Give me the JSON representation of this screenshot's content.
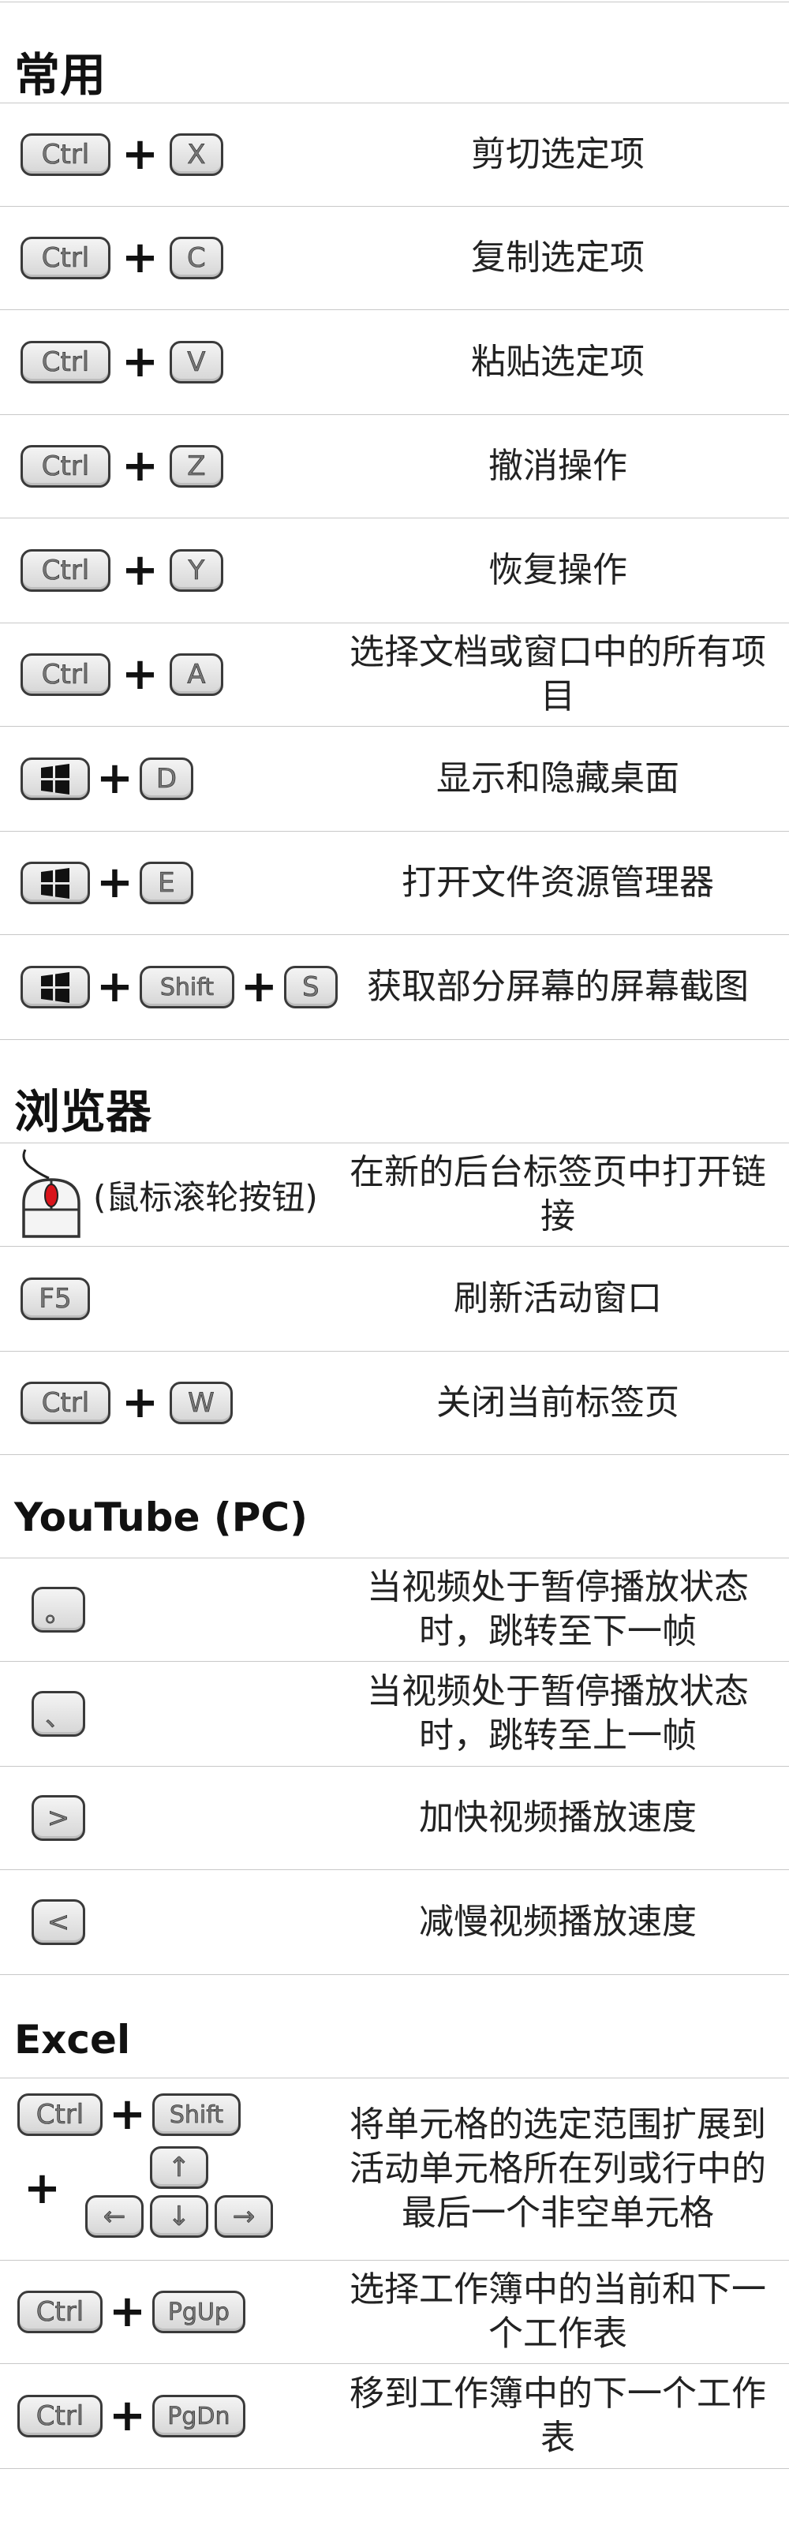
{
  "sections": {
    "common": {
      "heading": "常用",
      "rows": [
        {
          "k1": "Ctrl",
          "plus": "+",
          "k2": "X",
          "desc": "剪切选定项"
        },
        {
          "k1": "Ctrl",
          "plus": "+",
          "k2": "C",
          "desc": "复制选定项"
        },
        {
          "k1": "Ctrl",
          "plus": "+",
          "k2": "V",
          "desc": "粘贴选定项"
        },
        {
          "k1": "Ctrl",
          "plus": "+",
          "k2": "Z",
          "desc": "撤消操作"
        },
        {
          "k1": "Ctrl",
          "plus": "+",
          "k2": "Y",
          "desc": "恢复操作"
        },
        {
          "k1": "Ctrl",
          "plus": "+",
          "k2": "A",
          "desc": "选择文档或窗口中的所有项目"
        },
        {
          "k1": "windows-logo-icon",
          "plus": "+",
          "k2": "D",
          "desc": "显示和隐藏桌面"
        },
        {
          "k1": "windows-logo-icon",
          "plus": "+",
          "k2": "E",
          "desc": "打开文件资源管理器"
        },
        {
          "k1": "windows-logo-icon",
          "plus": "+",
          "k2": "Shift",
          "plus2": "+",
          "k3": "S",
          "desc": "获取部分屏幕的屏幕截图"
        }
      ]
    },
    "browser": {
      "heading": "浏览器",
      "rows": [
        {
          "icon": "mouse-icon",
          "label": "(鼠标滚轮按钮)",
          "desc": "在新的后台标签页中打开链接"
        },
        {
          "k1": "F5",
          "desc": "刷新活动窗口"
        },
        {
          "k1": "Ctrl",
          "plus": "+",
          "k2": "W",
          "desc": "关闭当前标签页"
        }
      ]
    },
    "youtube": {
      "heading": "YouTube (PC)",
      "rows": [
        {
          "k1": "。",
          "desc": "当视频处于暂停播放状态时，跳转至下一帧"
        },
        {
          "k1": "、",
          "desc": "当视频处于暂停播放状态时，跳转至上一帧"
        },
        {
          "k1": ">",
          "desc": "加快视频播放速度"
        },
        {
          "k1": "<",
          "desc": "减慢视频播放速度"
        }
      ]
    },
    "excel": {
      "heading": "Excel",
      "rows": [
        {
          "k1": "Ctrl",
          "plus": "+",
          "k2": "Shift",
          "plus2": "+",
          "arrows": [
            "↑",
            "←",
            "↓",
            "→"
          ],
          "desc": "将单元格的选定范围扩展到活动单元格所在列或行中的最后一个非空单元格"
        },
        {
          "k1": "Ctrl",
          "plus": "+",
          "k2": "PgUp",
          "desc": "选择工作簿中的当前和下一个工作表"
        },
        {
          "k1": "Ctrl",
          "plus": "+",
          "k2": "PgDn",
          "desc": "移到工作簿中的下一个工作表"
        }
      ]
    }
  },
  "colors": {
    "mouse_button": "#d9141b",
    "key_fill": "#e2e2e2",
    "key_border": "#3a3a3a",
    "divider": "#c8c8c8"
  }
}
